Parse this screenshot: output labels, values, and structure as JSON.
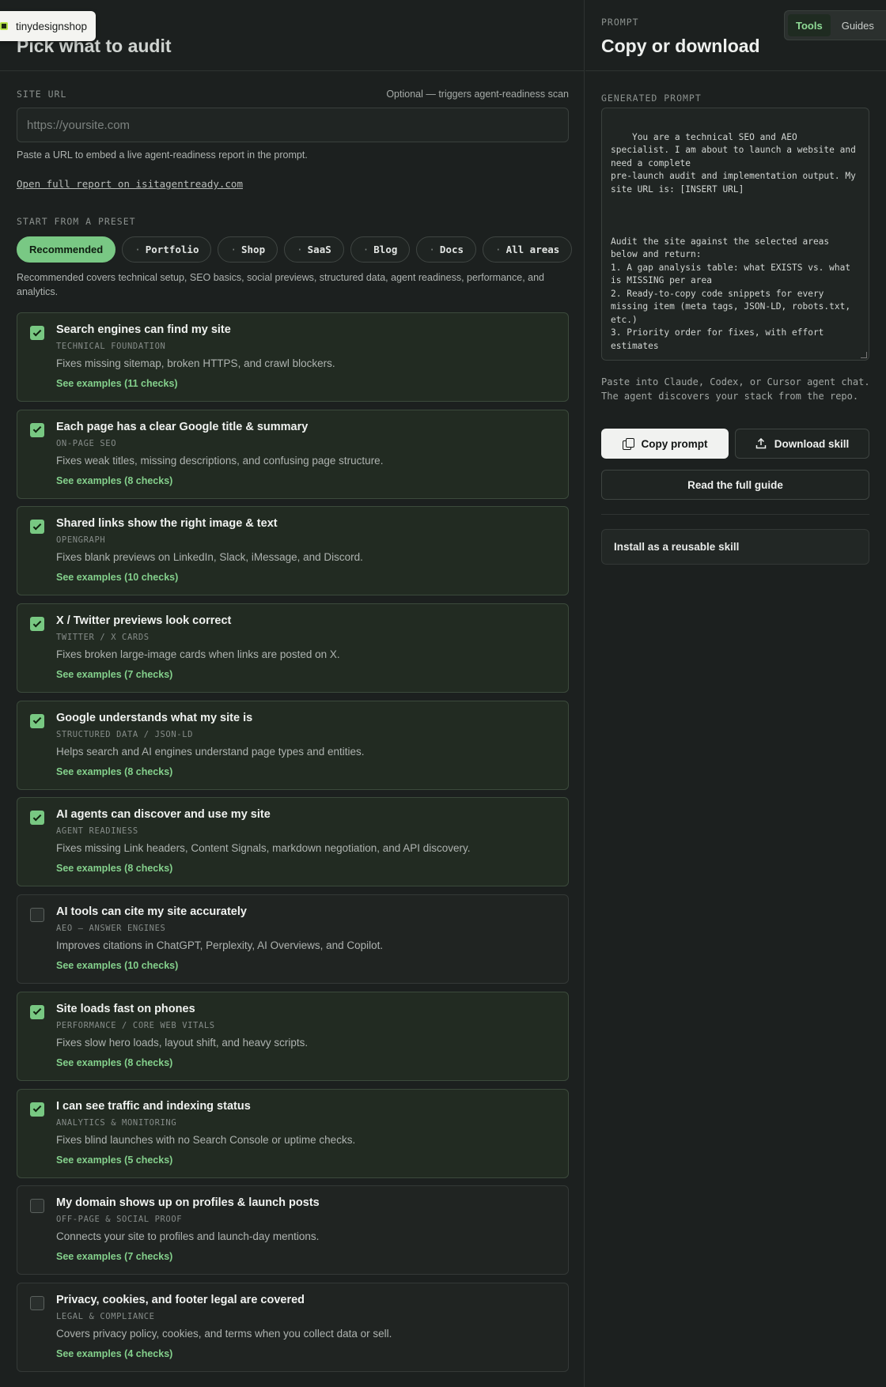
{
  "brand": {
    "name": "tinydesignshop"
  },
  "left": {
    "title": "Pick what to audit",
    "site_url": {
      "label": "SITE URL",
      "hint": "Optional — triggers agent-readiness scan",
      "placeholder": "https://yoursite.com",
      "help": "Paste a URL to embed a live agent-readiness report in the prompt.",
      "report_link": "Open full report on isitagentready.com"
    },
    "preset": {
      "label": "START FROM A PRESET",
      "options": [
        "Recommended",
        "Portfolio",
        "Shop",
        "SaaS",
        "Blog",
        "Docs",
        "All areas"
      ],
      "active": "Recommended",
      "description": "Recommended covers technical setup, SEO basics, social previews, structured data, agent readiness, performance, and analytics."
    },
    "cards": [
      {
        "title": "Search engines can find my site",
        "tag": "TECHNICAL FOUNDATION",
        "desc": "Fixes missing sitemap, broken HTTPS, and crawl blockers.",
        "link": "See examples (11 checks)",
        "checked": true
      },
      {
        "title": "Each page has a clear Google title & summary",
        "tag": "ON-PAGE SEO",
        "desc": "Fixes weak titles, missing descriptions, and confusing page structure.",
        "link": "See examples (8 checks)",
        "checked": true
      },
      {
        "title": "Shared links show the right image & text",
        "tag": "OPENGRAPH",
        "desc": "Fixes blank previews on LinkedIn, Slack, iMessage, and Discord.",
        "link": "See examples (10 checks)",
        "checked": true
      },
      {
        "title": "X / Twitter previews look correct",
        "tag": "TWITTER / X CARDS",
        "desc": "Fixes broken large-image cards when links are posted on X.",
        "link": "See examples (7 checks)",
        "checked": true
      },
      {
        "title": "Google understands what my site is",
        "tag": "STRUCTURED DATA / JSON-LD",
        "desc": "Helps search and AI engines understand page types and entities.",
        "link": "See examples (8 checks)",
        "checked": true
      },
      {
        "title": "AI agents can discover and use my site",
        "tag": "AGENT READINESS",
        "desc": "Fixes missing Link headers, Content Signals, markdown negotiation, and API discovery.",
        "link": "See examples (8 checks)",
        "checked": true
      },
      {
        "title": "AI tools can cite my site accurately",
        "tag": "AEO — ANSWER ENGINES",
        "desc": "Improves citations in ChatGPT, Perplexity, AI Overviews, and Copilot.",
        "link": "See examples (10 checks)",
        "checked": false
      },
      {
        "title": "Site loads fast on phones",
        "tag": "PERFORMANCE / CORE WEB VITALS",
        "desc": "Fixes slow hero loads, layout shift, and heavy scripts.",
        "link": "See examples (8 checks)",
        "checked": true
      },
      {
        "title": "I can see traffic and indexing status",
        "tag": "ANALYTICS & MONITORING",
        "desc": "Fixes blind launches with no Search Console or uptime checks.",
        "link": "See examples (5 checks)",
        "checked": true
      },
      {
        "title": "My domain shows up on profiles & launch posts",
        "tag": "OFF-PAGE & SOCIAL PROOF",
        "desc": "Connects your site to profiles and launch-day mentions.",
        "link": "See examples (7 checks)",
        "checked": false
      },
      {
        "title": "Privacy, cookies, and footer legal are covered",
        "tag": "LEGAL & COMPLIANCE",
        "desc": "Covers privacy policy, cookies, and terms when you collect data or sell.",
        "link": "See examples (4 checks)",
        "checked": false
      }
    ]
  },
  "right": {
    "eyebrow": "PROMPT",
    "title": "Copy or download",
    "nav": {
      "tabs": [
        "Tools",
        "Guides"
      ],
      "active": "Tools"
    },
    "generated_label": "GENERATED PROMPT",
    "prompt_text": "You are a technical SEO and AEO specialist. I am about to launch a website and need a complete\npre-launch audit and implementation output. My site URL is: [INSERT URL]\n\n\n\nAudit the site against the selected areas below and return:\n1. A gap analysis table: what EXISTS vs. what is MISSING per area\n2. Ready-to-copy code snippets for every missing item (meta tags, JSON-LD, robots.txt, etc.)\n3. Priority order for fixes, with effort estimates\n\nUser context: The person sharing this prompt",
    "paste_note": "Paste into Claude, Codex, or Cursor agent chat. The agent discovers your stack from the repo.",
    "copy_label": "Copy prompt",
    "download_label": "Download skill",
    "guide_label": "Read the full guide",
    "skill_label": "Install as a reusable skill"
  }
}
